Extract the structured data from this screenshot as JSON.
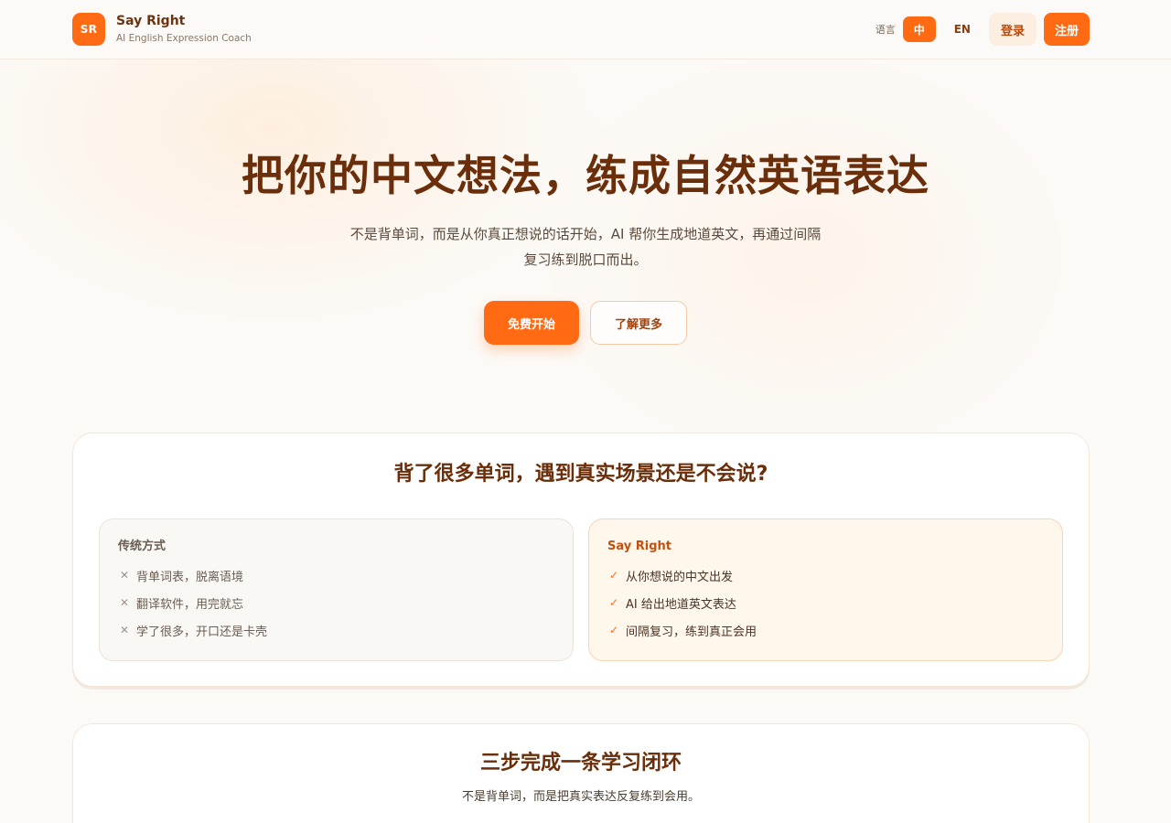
{
  "brand": {
    "logo_text": "SR",
    "name": "Say Right",
    "tagline": "AI English Expression Coach"
  },
  "nav": {
    "language_label": "语言",
    "lang_zh": "中",
    "lang_en": "EN",
    "active_lang": "中",
    "login": "登录",
    "signup": "注册"
  },
  "hero": {
    "title": "把你的中文想法，练成自然英语表达",
    "subtitle_line1": "不是背单词，而是从你真正想说的话开始，AI 帮你生成地道英文，再通过间隔",
    "subtitle_line2": "复习练到脱口而出。",
    "cta_primary": "免费开始",
    "cta_secondary": "了解更多"
  },
  "compare": {
    "title": "背了很多单词，遇到真实场景还是不会说?",
    "traditional": {
      "title": "传统方式",
      "items": [
        "背单词表，脱离语境",
        "翻译软件，用完就忘",
        "学了很多，开口还是卡壳"
      ]
    },
    "sayright": {
      "title": "Say Right",
      "items": [
        "从你想说的中文出发",
        "AI 给出地道英文表达",
        "间隔复习，练到真正会用"
      ]
    }
  },
  "steps": {
    "title": "三步完成一条学习闭环",
    "subtitle": "不是背单词，而是把真实表达反复练到会用。"
  },
  "colors": {
    "accent": "#ff6a13",
    "heading": "#6b2e0a",
    "background": "#fcfaf7"
  }
}
